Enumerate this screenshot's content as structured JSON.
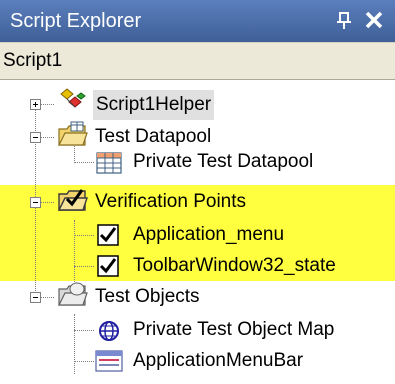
{
  "panel": {
    "title": "Script Explorer",
    "pin_icon": "pin-icon",
    "close_icon": "close-icon",
    "script_name": "Script1"
  },
  "tree": {
    "items": [
      {
        "label": "Script1Helper",
        "icon": "helper-icon",
        "expander": "plus"
      },
      {
        "label": "Test Datapool",
        "icon": "folder-datapool-icon",
        "expander": "minus"
      },
      {
        "label": "Private Test Datapool",
        "icon": "datapool-table-icon"
      },
      {
        "label": "Verification Points",
        "icon": "folder-verification-icon",
        "expander": "minus"
      },
      {
        "label": "Application_menu",
        "icon": "checkbox-icon"
      },
      {
        "label": "ToolbarWindow32_state",
        "icon": "checkbox-icon"
      },
      {
        "label": "Test Objects",
        "icon": "folder-objects-icon",
        "expander": "minus"
      },
      {
        "label": "Private Test Object Map",
        "icon": "globe-icon"
      },
      {
        "label": "ApplicationMenuBar",
        "icon": "menubar-icon"
      }
    ]
  },
  "colors": {
    "titlebar": "#4d6fa8",
    "highlight": "#ffff40",
    "toolbar": "#ece9d8"
  }
}
